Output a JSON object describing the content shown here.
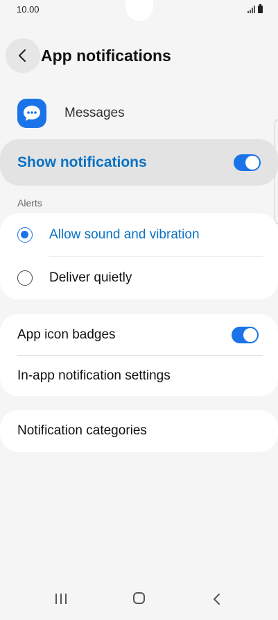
{
  "status_bar": {
    "time": "10.00"
  },
  "header": {
    "title": "App notifications"
  },
  "app": {
    "name": "Messages",
    "icon": "messages-bubble-icon",
    "color": "#1a73e8"
  },
  "show_notifications": {
    "label": "Show notifications",
    "enabled": true
  },
  "alerts": {
    "section_title": "Alerts",
    "options": [
      {
        "label": "Allow sound and vibration",
        "selected": true
      },
      {
        "label": "Deliver quietly",
        "selected": false
      }
    ]
  },
  "badges": {
    "label": "App icon badges",
    "enabled": true
  },
  "in_app": {
    "label": "In-app notification settings"
  },
  "categories": {
    "label": "Notification categories"
  },
  "colors": {
    "accent": "#1a73e8",
    "accent_text": "#0a72c4",
    "background": "#f5f5f5"
  }
}
